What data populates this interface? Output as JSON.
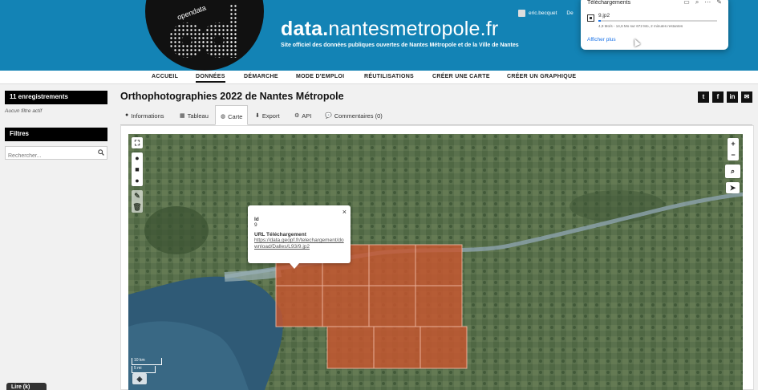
{
  "header": {
    "logo_text": "opendata",
    "title_bold": "data.",
    "title_rest": "nantesmetropole.fr",
    "subtitle": "Site officiel des données publiques ouvertes de Nantes Métropole et de la Ville de Nantes",
    "user": "eric.becquet",
    "user_extra": "De"
  },
  "downloads": {
    "title": "Téléchargements",
    "file_name": "9.jp2",
    "progress_percent": 2,
    "status": "4,9 Mo/s - 14,6 Mo sur 672 Mo, 2 minutes restantes",
    "show_more": "Afficher plus"
  },
  "nav": {
    "items": [
      "ACCUEIL",
      "DONNÉES",
      "DÉMARCHE",
      "MODE D'EMPLOI",
      "RÉUTILISATIONS",
      "CRÉER UNE CARTE",
      "CRÉER UN GRAPHIQUE"
    ],
    "active": "DONNÉES"
  },
  "sidebar": {
    "records": "11 enregistrements",
    "filter_note": "Aucun filtre actif",
    "filters_title": "Filtres",
    "search_placeholder": "Rechercher...",
    "bottom_tab": "Lire (k)"
  },
  "main": {
    "title": "Orthophotographies 2022 de Nantes Métropole",
    "tabs": [
      "Informations",
      "Tableau",
      "Carte",
      "Export",
      "API",
      "Commentaires (0)"
    ],
    "active_tab": "Carte",
    "share": [
      "twitter",
      "facebook",
      "linkedin",
      "email"
    ]
  },
  "map": {
    "popup": {
      "id_label": "Id",
      "id_value": "9",
      "url_label": "URL Téléchargement",
      "url_value": "https://data.geopf.fr/telechargement/download/Dalles/L93/9.jp2"
    },
    "zoom_in": "+",
    "zoom_out": "−",
    "scale_km": "10 km",
    "scale_mi": "5 mi",
    "tile_color": "#c8552e"
  }
}
